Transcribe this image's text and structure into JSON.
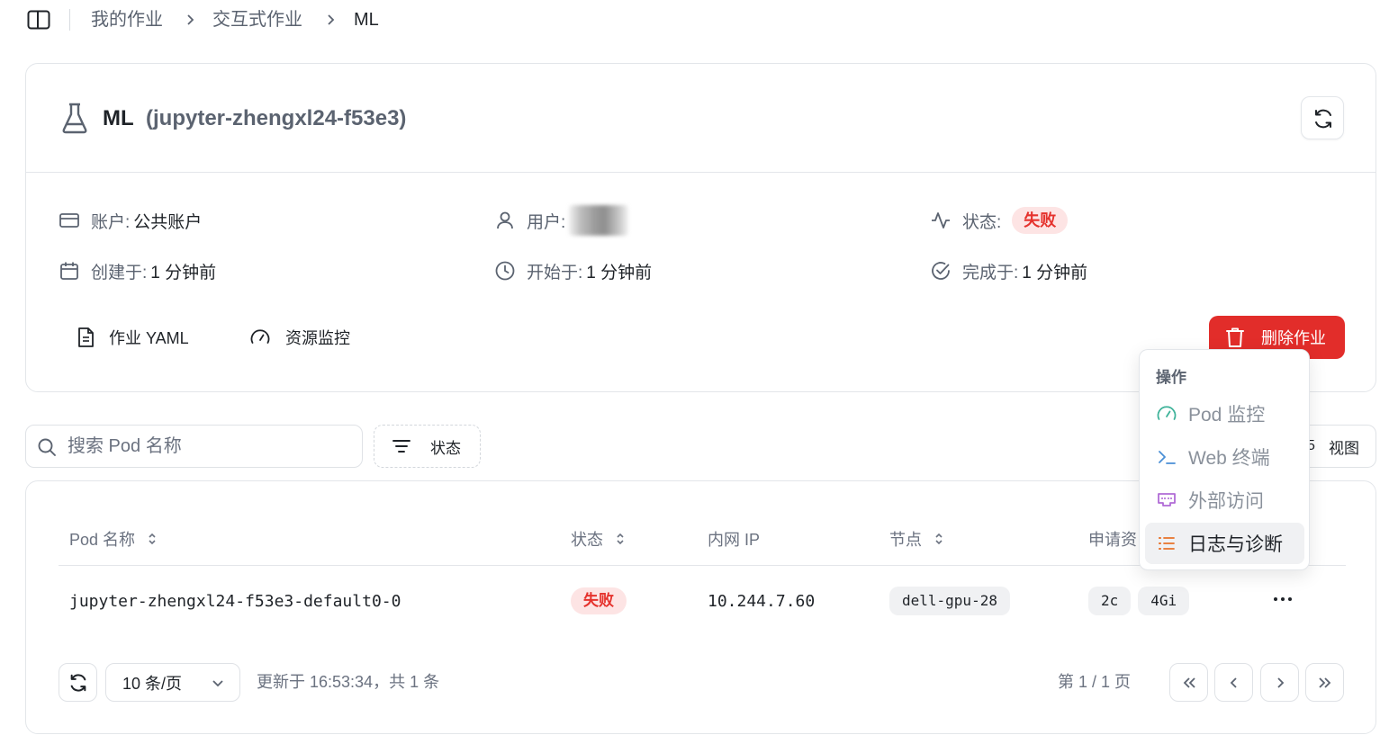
{
  "breadcrumb": {
    "items": [
      "我的作业",
      "交互式作业",
      "ML"
    ]
  },
  "job": {
    "name": "ML",
    "id": "(jupyter-zhengxl24-f53e3)",
    "account_label": "账户:",
    "account_value": "公共账户",
    "user_label": "用户:",
    "status_label": "状态:",
    "status_value": "失败",
    "created_label": "创建于:",
    "created_value": "1 分钟前",
    "started_label": "开始于:",
    "started_value": "1 分钟前",
    "finished_label": "完成于:",
    "finished_value": "1 分钟前",
    "yaml_label": "作业 YAML",
    "monitor_label": "资源监控",
    "delete_label": "删除作业"
  },
  "toolbar": {
    "search_placeholder": "搜索 Pod 名称",
    "status_filter_label": "状态",
    "view_label": "视图"
  },
  "table": {
    "columns": [
      "Pod 名称",
      "状态",
      "内网 IP",
      "节点",
      "申请资"
    ],
    "rows": [
      {
        "pod_name": "jupyter-zhengxl24-f53e3-default0-0",
        "status": "失败",
        "ip": "10.244.7.60",
        "node": "dell-gpu-28",
        "cpu": "2c",
        "mem": "4Gi"
      }
    ]
  },
  "pagination": {
    "page_size": "10 条/页",
    "updated_text": "更新于 16:53:34，共 1 条",
    "page_info": "第 1 / 1 页"
  },
  "menu": {
    "title": "操作",
    "items": [
      {
        "label": "Pod 监控",
        "icon": "gauge-icon",
        "color": "#3fb39a"
      },
      {
        "label": "Web 终端",
        "icon": "terminal-icon",
        "color": "#4a8fd6"
      },
      {
        "label": "外部访问",
        "icon": "ethernet-port-icon",
        "color": "#b06bd6"
      },
      {
        "label": "日志与诊断",
        "icon": "list-icon",
        "color": "#e8722a"
      }
    ]
  },
  "colors": {
    "danger": "#e22d2a",
    "danger_badge_bg": "#fde4e4",
    "border": "#e3e6ea"
  }
}
